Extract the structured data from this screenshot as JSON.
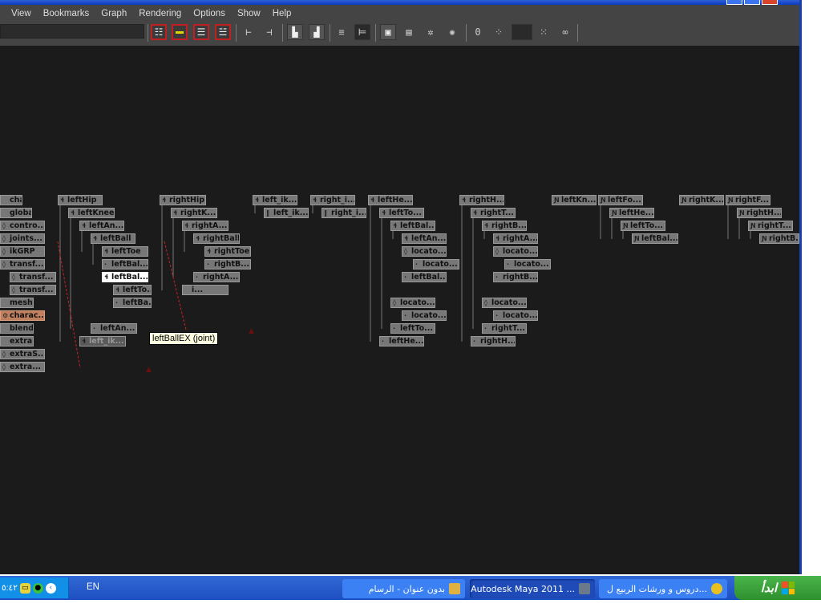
{
  "menu": [
    "View",
    "Bookmarks",
    "Graph",
    "Rendering",
    "Options",
    "Show",
    "Help"
  ],
  "search": {
    "value": ""
  },
  "toolbar": {
    "numeric_label": "0"
  },
  "tooltip": "leftBallEX (joint)",
  "nodes": [
    {
      "label": "charac...",
      "icon": ""
    },
    {
      "label": "global...",
      "icon": ""
    },
    {
      "label": "contro...",
      "icon": "◊"
    },
    {
      "label": "joints...",
      "icon": "◊"
    },
    {
      "label": "ikGRP",
      "icon": "◊"
    },
    {
      "label": "transf...",
      "icon": "◊"
    },
    {
      "label": "transf...",
      "icon": "◊"
    },
    {
      "label": "transf...",
      "icon": "◊"
    },
    {
      "label": "meshG...",
      "icon": ""
    },
    {
      "label": "charac...",
      "icon": "⚙"
    },
    {
      "label": "blendS...",
      "icon": ""
    },
    {
      "label": "extra...",
      "icon": ""
    },
    {
      "label": "extraS...",
      "icon": "◊"
    },
    {
      "label": "extra...",
      "icon": "◊"
    },
    {
      "label": "leftHip",
      "icon": "ɬ"
    },
    {
      "label": "leftKnee",
      "icon": "ɬ"
    },
    {
      "label": "leftAn...",
      "icon": "ɬ"
    },
    {
      "label": "leftBall",
      "icon": "ɬ"
    },
    {
      "label": "leftToe",
      "icon": "ɬ"
    },
    {
      "label": "leftBal...",
      "icon": "·"
    },
    {
      "label": "leftBal...",
      "icon": "ɬ"
    },
    {
      "label": "leftTo...",
      "icon": "ɬ"
    },
    {
      "label": "leftBa...",
      "icon": "·"
    },
    {
      "label": "leftAn...",
      "icon": "·"
    },
    {
      "label": "left_ik...",
      "icon": "ɬ"
    },
    {
      "label": "rightHip",
      "icon": "ɬ"
    },
    {
      "label": "rightK...",
      "icon": "ɬ"
    },
    {
      "label": "rightA...",
      "icon": "ɬ"
    },
    {
      "label": "rightBall",
      "icon": "ɬ"
    },
    {
      "label": "rightToe",
      "icon": "ɬ"
    },
    {
      "label": "rightB...",
      "icon": "·"
    },
    {
      "label": "rightA...",
      "icon": "·"
    },
    {
      "label": "i...",
      "icon": ""
    },
    {
      "label": "left_ik...",
      "icon": "ɬ"
    },
    {
      "label": "left_ik...",
      "icon": "‖"
    },
    {
      "label": "right_i...",
      "icon": "ɬ"
    },
    {
      "label": "right_i...",
      "icon": "‖"
    },
    {
      "label": "leftHe...",
      "icon": "ɬ"
    },
    {
      "label": "leftTo...",
      "icon": "ɬ"
    },
    {
      "label": "leftBal...",
      "icon": "ɬ"
    },
    {
      "label": "leftAn...",
      "icon": "ɬ"
    },
    {
      "label": "locato...",
      "icon": "◊"
    },
    {
      "label": "locato...",
      "icon": "·"
    },
    {
      "label": "leftBal...",
      "icon": "·"
    },
    {
      "label": "locato...",
      "icon": "◊"
    },
    {
      "label": "locato...",
      "icon": "·"
    },
    {
      "label": "leftTo...",
      "icon": "·"
    },
    {
      "label": "leftHe...",
      "icon": "·"
    },
    {
      "label": "rightH...",
      "icon": "ɬ"
    },
    {
      "label": "rightT...",
      "icon": "ɬ"
    },
    {
      "label": "rightB...",
      "icon": "ɬ"
    },
    {
      "label": "rightA...",
      "icon": "ɬ"
    },
    {
      "label": "locato...",
      "icon": "◊"
    },
    {
      "label": "locato...",
      "icon": "·"
    },
    {
      "label": "rightB...",
      "icon": "·"
    },
    {
      "label": "locato...",
      "icon": "◊"
    },
    {
      "label": "locato...",
      "icon": "·"
    },
    {
      "label": "rightT...",
      "icon": "·"
    },
    {
      "label": "rightH...",
      "icon": "·"
    },
    {
      "label": "leftKn...",
      "icon": "Ɲ"
    },
    {
      "label": "leftFo...",
      "icon": "Ɲ"
    },
    {
      "label": "leftHe...",
      "icon": "Ɲ"
    },
    {
      "label": "leftTo...",
      "icon": "Ɲ"
    },
    {
      "label": "leftBal...",
      "icon": "Ɲ"
    },
    {
      "label": "rightK...",
      "icon": "Ɲ"
    },
    {
      "label": "rightF...",
      "icon": "Ɲ"
    },
    {
      "label": "rightH...",
      "icon": "Ɲ"
    },
    {
      "label": "rightT...",
      "icon": "Ɲ"
    },
    {
      "label": "rightB...",
      "icon": "Ɲ"
    }
  ],
  "taskbar": {
    "clock": "٥:٤٢",
    "language": "EN",
    "tasks": [
      "بدون عنوان - الرسام",
      "Autodesk Maya 2011 ...",
      "دروس و ورشات الربيع ل..."
    ],
    "start_label": "ابدأ"
  },
  "colors": {
    "graph_bg": "#1b1b1b",
    "node_bg": "#777777",
    "selected_node": "#ffffff",
    "highlight_node": "#c08060",
    "connection_red": "#cc2222",
    "taskbar_blue": "#2458cc",
    "start_green": "#3aa53a"
  }
}
